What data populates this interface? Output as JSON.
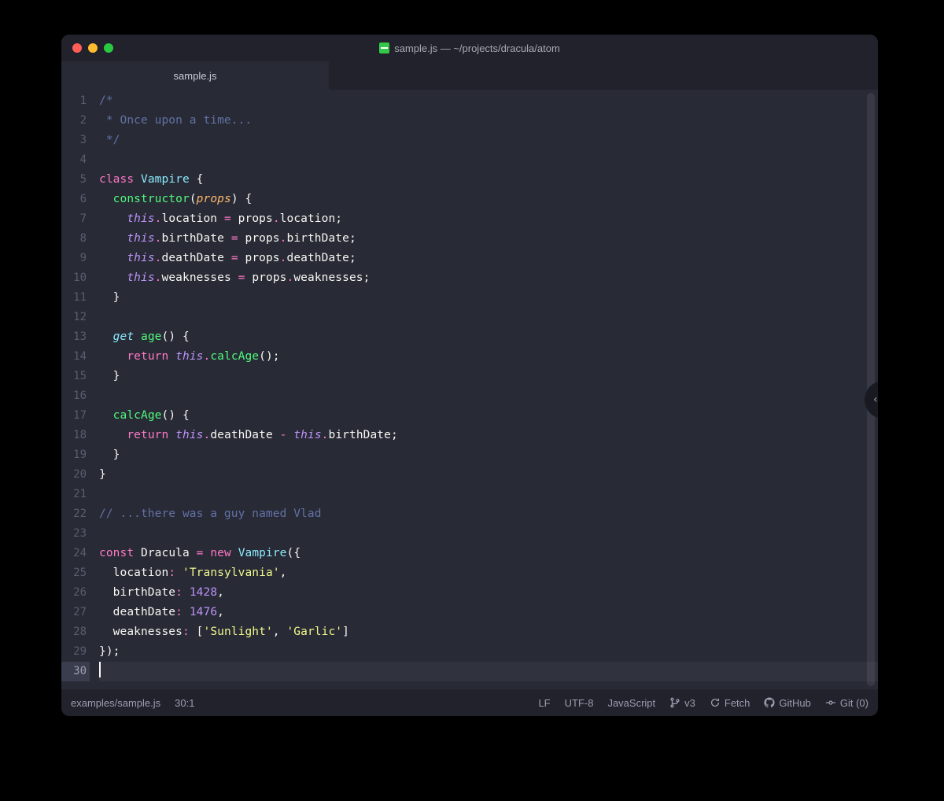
{
  "titlebar": {
    "title": "sample.js — ~/projects/dracula/atom"
  },
  "tabs": [
    {
      "label": "sample.js"
    }
  ],
  "gutter": {
    "line_count": 30,
    "current_line": 30
  },
  "code": {
    "lines": [
      [
        {
          "c": "c-comment",
          "t": "/*"
        }
      ],
      [
        {
          "c": "c-comment",
          "t": " * Once upon a time..."
        }
      ],
      [
        {
          "c": "c-comment",
          "t": " */"
        }
      ],
      [],
      [
        {
          "c": "c-keyword",
          "t": "class"
        },
        {
          "c": "c-punc",
          "t": " "
        },
        {
          "c": "c-class",
          "t": "Vampire"
        },
        {
          "c": "c-punc",
          "t": " {"
        }
      ],
      [
        {
          "c": "c-punc",
          "t": "  "
        },
        {
          "c": "c-func",
          "t": "constructor"
        },
        {
          "c": "c-punc",
          "t": "("
        },
        {
          "c": "c-param",
          "t": "props"
        },
        {
          "c": "c-punc",
          "t": ") {"
        }
      ],
      [
        {
          "c": "c-punc",
          "t": "    "
        },
        {
          "c": "c-this",
          "t": "this"
        },
        {
          "c": "c-pink",
          "t": "."
        },
        {
          "c": "c-prop",
          "t": "location"
        },
        {
          "c": "c-punc",
          "t": " "
        },
        {
          "c": "c-pink",
          "t": "="
        },
        {
          "c": "c-punc",
          "t": " props"
        },
        {
          "c": "c-pink",
          "t": "."
        },
        {
          "c": "c-prop",
          "t": "location;"
        }
      ],
      [
        {
          "c": "c-punc",
          "t": "    "
        },
        {
          "c": "c-this",
          "t": "this"
        },
        {
          "c": "c-pink",
          "t": "."
        },
        {
          "c": "c-prop",
          "t": "birthDate"
        },
        {
          "c": "c-punc",
          "t": " "
        },
        {
          "c": "c-pink",
          "t": "="
        },
        {
          "c": "c-punc",
          "t": " props"
        },
        {
          "c": "c-pink",
          "t": "."
        },
        {
          "c": "c-prop",
          "t": "birthDate;"
        }
      ],
      [
        {
          "c": "c-punc",
          "t": "    "
        },
        {
          "c": "c-this",
          "t": "this"
        },
        {
          "c": "c-pink",
          "t": "."
        },
        {
          "c": "c-prop",
          "t": "deathDate"
        },
        {
          "c": "c-punc",
          "t": " "
        },
        {
          "c": "c-pink",
          "t": "="
        },
        {
          "c": "c-punc",
          "t": " props"
        },
        {
          "c": "c-pink",
          "t": "."
        },
        {
          "c": "c-prop",
          "t": "deathDate;"
        }
      ],
      [
        {
          "c": "c-punc",
          "t": "    "
        },
        {
          "c": "c-this",
          "t": "this"
        },
        {
          "c": "c-pink",
          "t": "."
        },
        {
          "c": "c-prop",
          "t": "weaknesses"
        },
        {
          "c": "c-punc",
          "t": " "
        },
        {
          "c": "c-pink",
          "t": "="
        },
        {
          "c": "c-punc",
          "t": " props"
        },
        {
          "c": "c-pink",
          "t": "."
        },
        {
          "c": "c-prop",
          "t": "weaknesses;"
        }
      ],
      [
        {
          "c": "c-punc",
          "t": "  }"
        }
      ],
      [],
      [
        {
          "c": "c-punc",
          "t": "  "
        },
        {
          "c": "c-get",
          "t": "get"
        },
        {
          "c": "c-punc",
          "t": " "
        },
        {
          "c": "c-func",
          "t": "age"
        },
        {
          "c": "c-punc",
          "t": "() {"
        }
      ],
      [
        {
          "c": "c-punc",
          "t": "    "
        },
        {
          "c": "c-keyword",
          "t": "return"
        },
        {
          "c": "c-punc",
          "t": " "
        },
        {
          "c": "c-this",
          "t": "this"
        },
        {
          "c": "c-pink",
          "t": "."
        },
        {
          "c": "c-func",
          "t": "calcAge"
        },
        {
          "c": "c-punc",
          "t": "();"
        }
      ],
      [
        {
          "c": "c-punc",
          "t": "  }"
        }
      ],
      [],
      [
        {
          "c": "c-punc",
          "t": "  "
        },
        {
          "c": "c-func",
          "t": "calcAge"
        },
        {
          "c": "c-punc",
          "t": "() {"
        }
      ],
      [
        {
          "c": "c-punc",
          "t": "    "
        },
        {
          "c": "c-keyword",
          "t": "return"
        },
        {
          "c": "c-punc",
          "t": " "
        },
        {
          "c": "c-this",
          "t": "this"
        },
        {
          "c": "c-pink",
          "t": "."
        },
        {
          "c": "c-prop",
          "t": "deathDate"
        },
        {
          "c": "c-punc",
          "t": " "
        },
        {
          "c": "c-pink",
          "t": "-"
        },
        {
          "c": "c-punc",
          "t": " "
        },
        {
          "c": "c-this",
          "t": "this"
        },
        {
          "c": "c-pink",
          "t": "."
        },
        {
          "c": "c-prop",
          "t": "birthDate;"
        }
      ],
      [
        {
          "c": "c-punc",
          "t": "  }"
        }
      ],
      [
        {
          "c": "c-punc",
          "t": "}"
        }
      ],
      [],
      [
        {
          "c": "c-comment",
          "t": "// ...there was a guy named Vlad"
        }
      ],
      [],
      [
        {
          "c": "c-keyword",
          "t": "const"
        },
        {
          "c": "c-punc",
          "t": " "
        },
        {
          "c": "c-prop",
          "t": "Dracula"
        },
        {
          "c": "c-punc",
          "t": " "
        },
        {
          "c": "c-pink",
          "t": "="
        },
        {
          "c": "c-punc",
          "t": " "
        },
        {
          "c": "c-pink",
          "t": "new"
        },
        {
          "c": "c-punc",
          "t": " "
        },
        {
          "c": "c-class",
          "t": "Vampire"
        },
        {
          "c": "c-punc",
          "t": "({"
        }
      ],
      [
        {
          "c": "c-punc",
          "t": "  location"
        },
        {
          "c": "c-pink",
          "t": ":"
        },
        {
          "c": "c-punc",
          "t": " "
        },
        {
          "c": "c-str",
          "t": "'Transylvania'"
        },
        {
          "c": "c-punc",
          "t": ","
        }
      ],
      [
        {
          "c": "c-punc",
          "t": "  birthDate"
        },
        {
          "c": "c-pink",
          "t": ":"
        },
        {
          "c": "c-punc",
          "t": " "
        },
        {
          "c": "c-num",
          "t": "1428"
        },
        {
          "c": "c-punc",
          "t": ","
        }
      ],
      [
        {
          "c": "c-punc",
          "t": "  deathDate"
        },
        {
          "c": "c-pink",
          "t": ":"
        },
        {
          "c": "c-punc",
          "t": " "
        },
        {
          "c": "c-num",
          "t": "1476"
        },
        {
          "c": "c-punc",
          "t": ","
        }
      ],
      [
        {
          "c": "c-punc",
          "t": "  weaknesses"
        },
        {
          "c": "c-pink",
          "t": ":"
        },
        {
          "c": "c-punc",
          "t": " ["
        },
        {
          "c": "c-str",
          "t": "'Sunlight'"
        },
        {
          "c": "c-punc",
          "t": ", "
        },
        {
          "c": "c-str",
          "t": "'Garlic'"
        },
        {
          "c": "c-punc",
          "t": "]"
        }
      ],
      [
        {
          "c": "c-punc",
          "t": "});"
        }
      ],
      []
    ]
  },
  "statusbar": {
    "path": "examples/sample.js",
    "cursor": "30:1",
    "line_ending": "LF",
    "encoding": "UTF-8",
    "language": "JavaScript",
    "branch": "v3",
    "fetch": "Fetch",
    "github": "GitHub",
    "git": "Git (0)"
  },
  "sidehandle": {
    "glyph": "‹"
  }
}
